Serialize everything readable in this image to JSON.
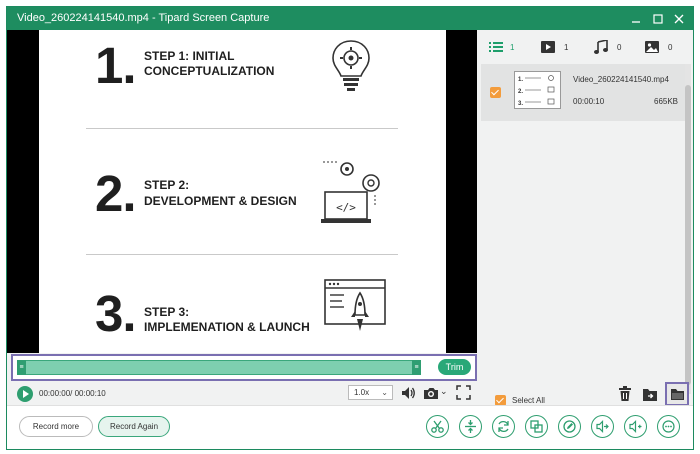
{
  "window": {
    "title": "Video_260224141540.mp4 - Tipard Screen Capture",
    "accent_color": "#1e8d60"
  },
  "slide": {
    "steps": [
      {
        "number": "1.",
        "line1": "STEP 1: INITIAL",
        "line2": "CONCEPTUALIZATION",
        "icon": "lightbulb-gear-icon"
      },
      {
        "number": "2.",
        "line1": "STEP 2:",
        "line2": "DEVELOPMENT & DESIGN",
        "icon": "laptop-code-icon"
      },
      {
        "number": "3.",
        "line1": "STEP 3:",
        "line2": "IMPLEMENATION & LAUNCH",
        "icon": "browser-rocket-icon"
      }
    ]
  },
  "trim": {
    "button_label": "Trim"
  },
  "playback": {
    "time": "00:00:00/ 00:00:10",
    "speed": "1.0x"
  },
  "panel": {
    "tabs": [
      {
        "icon": "list-icon",
        "count": "1"
      },
      {
        "icon": "video-icon",
        "count": "1"
      },
      {
        "icon": "music-icon",
        "count": "0"
      },
      {
        "icon": "image-icon",
        "count": "0"
      }
    ],
    "file": {
      "name": "Video_260224141540.mp4",
      "duration": "00:00:10",
      "size": "665KB"
    },
    "select_all_label": "Select All"
  },
  "bottom": {
    "record_more": "Record more",
    "record_again": "Record Again",
    "tools": [
      "scissors-icon",
      "merge-icon",
      "convert-icon",
      "compress-icon",
      "edit-icon",
      "audio-export-icon",
      "volume-icon",
      "more-icon"
    ]
  }
}
